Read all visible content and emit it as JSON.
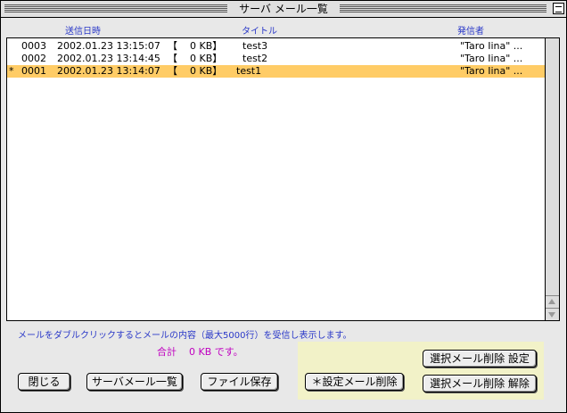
{
  "window": {
    "title": "サーバ メール一覧"
  },
  "columns": {
    "date": "送信日時",
    "title": "タイトル",
    "sender": "発信者"
  },
  "rows": [
    {
      "mark": "",
      "num": "0003",
      "date": "2002.01.23 13:15:07",
      "size": "【    0 KB】",
      "title": "test3",
      "sender": "\"Taro Iina\" ...",
      "selected": false
    },
    {
      "mark": "",
      "num": "0002",
      "date": "2002.01.23 13:14:45",
      "size": "【    0 KB】",
      "title": "test2",
      "sender": "\"Taro Iina\" ...",
      "selected": false
    },
    {
      "mark": "*",
      "num": "0001",
      "date": "2002.01.23 13:14:07",
      "size": "【    0 KB】",
      "title": "test1",
      "sender": "\"Taro Iina\" ...",
      "selected": true
    }
  ],
  "hint": "メールをダブルクリックするとメールの内容（最大5000行）を受信し表示します。",
  "total": "合計    0 KB です。",
  "buttons": {
    "close": "閉じる",
    "server_list": "サーバメール一覧",
    "save_file": "ファイル保存",
    "delete_marked": "＊設定メール削除",
    "mark_delete_set": "選択メール削除 設定",
    "mark_delete_clear": "選択メール削除 解除"
  },
  "colors": {
    "selection": "#ffcc66",
    "header_text": "#2a38c8",
    "total_text": "#c000c0",
    "panel_bg": "#f2f2c8"
  }
}
